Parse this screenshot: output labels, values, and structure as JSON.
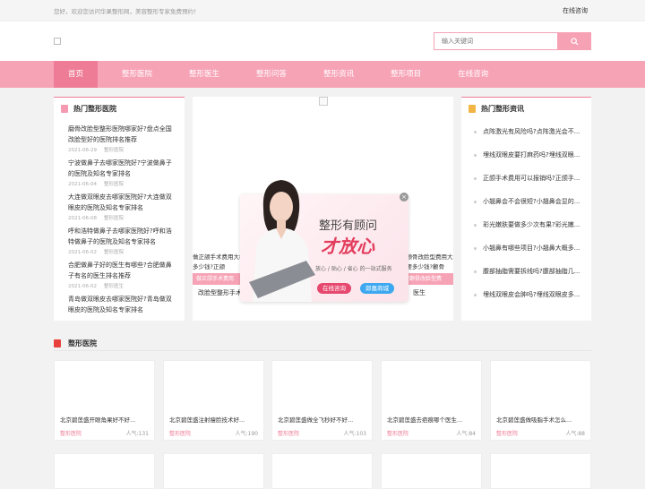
{
  "topbar": {
    "welcome": "您好，欢迎您访问华果整形网，美容整形专家免费预约！",
    "link": "在线咨询"
  },
  "search": {
    "placeholder": "输入关键词"
  },
  "nav": [
    "首页",
    "整形医院",
    "整形医生",
    "整形问答",
    "整形资讯",
    "整形项目",
    "在线咨询"
  ],
  "left_panel": {
    "title": "热门整形医院",
    "items": [
      {
        "title": "磨骨改脸型整形医院哪家好?盘点全国改脸型好的医院排名推荐",
        "date": "2021-06-29",
        "tag": "整形医院"
      },
      {
        "title": "宁波做鼻子去哪家医院好?宁波做鼻子的医院及知名专家排名",
        "date": "2021-06-04",
        "tag": "整形医院"
      },
      {
        "title": "大连做双眼皮去哪家医院好?大连做双眼皮的医院及知名专家排名",
        "date": "2021-06-08",
        "tag": "整形医院"
      },
      {
        "title": "呼和浩特做鼻子去哪家医院好?呼和浩特做鼻子的医院及知名专家排名",
        "date": "2021-06-02",
        "tag": "整形医院"
      },
      {
        "title": "合肥做鼻子好的医生有哪些?合肥做鼻子有名的医生排名推荐",
        "date": "2021-06-02",
        "tag": "整形医生"
      },
      {
        "title": "青岛做双眼皮去哪家医院好?青岛做双眼皮的医院及知名专家排名",
        "date": "",
        "tag": ""
      }
    ]
  },
  "mid": {
    "card_left": "做正颌手术费用大概多少钱?正颌",
    "card_left_tag": "做正颌手术费用",
    "card_right": "做颧骨改脸型费用大概要多少钱?颧骨",
    "card_right_tag": "做颧骨改脸型费",
    "caption_left": "改脸型整形手术",
    "caption_right": "医生"
  },
  "popup": {
    "line1": "整形有顾问",
    "line2": "才放心",
    "sub": "放心 / 贴心 / 省心 的一站式服务",
    "btn1": "在线咨询",
    "btn2": "郎嘉商城"
  },
  "right_panel": {
    "title": "热门整形资讯",
    "items": [
      "点阵激光有风险吗?点阵激光会不...",
      "埋线双眼皮要打麻药吗?埋线双眼...",
      "正颌手术费用可以报销吗?正颌手...",
      "小翘鼻会不会很短?小翘鼻会显的...",
      "彩光嫩肤要做多少次有果?彩光嫩...",
      "小翘鼻有哪些项目?小翘鼻大概多...",
      "腹部抽脂需要拆线吗?腹部抽脂几...",
      "埋线双眼皮会肿吗?埋线双眼皮多..."
    ]
  },
  "section": {
    "title": "整形医院"
  },
  "cards": [
    {
      "title": "北京碧莲盛开眼角果好不好...",
      "tag": "整形医院",
      "pv": "人气:131"
    },
    {
      "title": "北京碧莲盛注射瘦脸技术好...",
      "tag": "整形医院",
      "pv": "人气:190"
    },
    {
      "title": "北京碧莲盛做全飞秒好不好...",
      "tag": "整形医院",
      "pv": "人气:103"
    },
    {
      "title": "北京碧莲盛去疤痕哪个医生...",
      "tag": "整形医院",
      "pv": "人气:84"
    },
    {
      "title": "北京碧莲盛做吸脂手术怎么...",
      "tag": "整形医院",
      "pv": "人气:88"
    }
  ],
  "colors": {
    "accent": "#f7a3b6",
    "nav_active": "#ef7c96",
    "brand_red": "#e33c5c"
  }
}
